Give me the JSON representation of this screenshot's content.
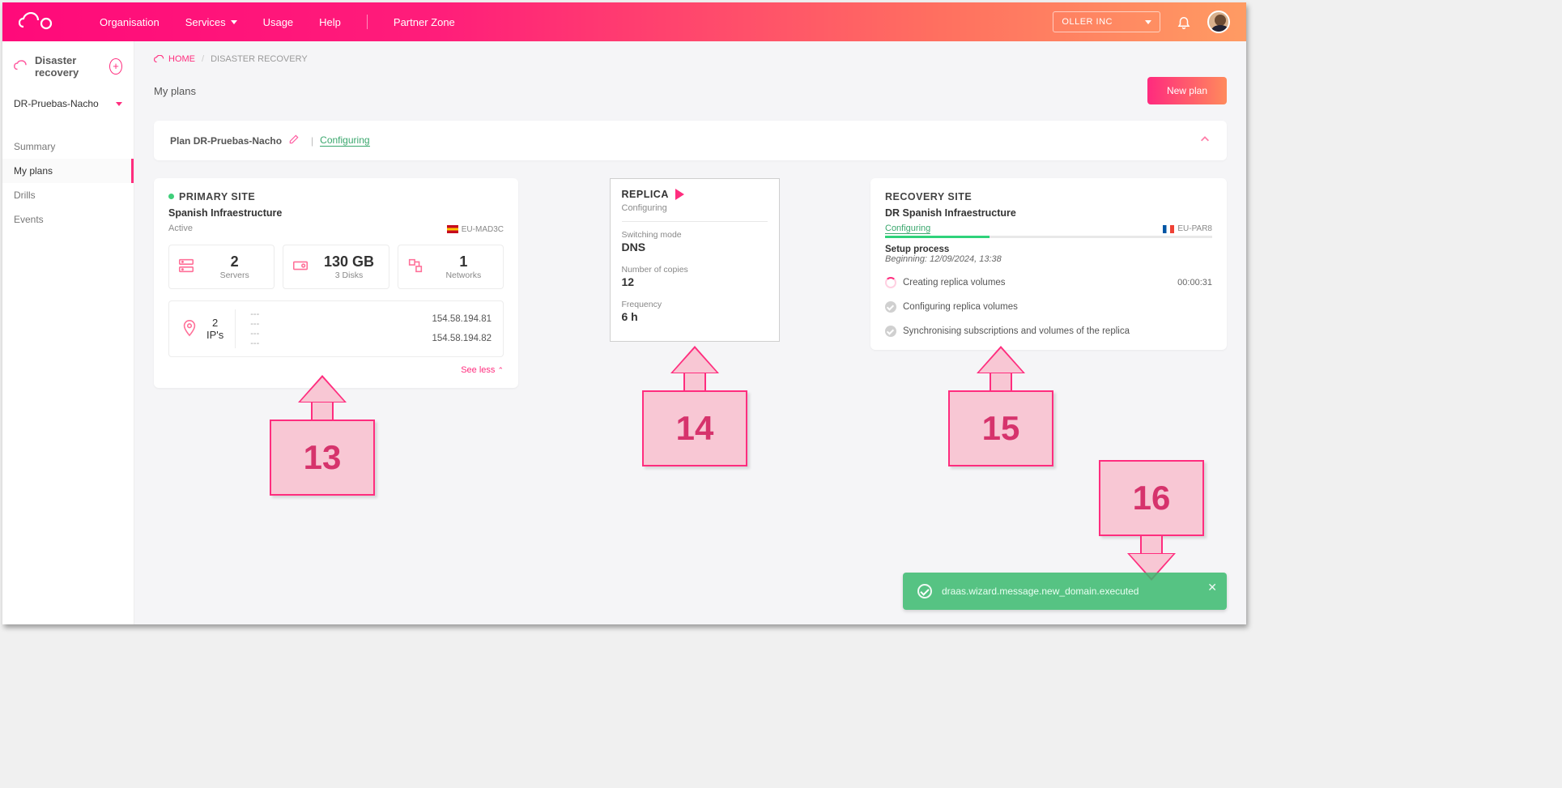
{
  "topbar": {
    "nav": [
      "Organisation",
      "Services",
      "Usage",
      "Help",
      "Partner Zone"
    ],
    "org": "OLLER INC"
  },
  "sidebar": {
    "title": "Disaster recovery",
    "planSelected": "DR-Pruebas-Nacho",
    "links": [
      "Summary",
      "My plans",
      "Drills",
      "Events"
    ],
    "activeIndex": 1
  },
  "breadcrumb": {
    "home": "HOME",
    "current": "DISASTER RECOVERY"
  },
  "page": {
    "title": "My plans",
    "newPlanBtn": "New plan"
  },
  "planBar": {
    "prefix": "Plan",
    "name": "DR-Pruebas-Nacho",
    "status": "Configuring"
  },
  "primary": {
    "heading": "PRIMARY SITE",
    "name": "Spanish Infraestructure",
    "state": "Active",
    "region": "EU-MAD3C",
    "stats": {
      "serversNum": "2",
      "serversLabel": "Servers",
      "disksNum": "130 GB",
      "disksLabel": "3 Disks",
      "netNum": "1",
      "netLabel": "Networks"
    },
    "ips": {
      "count": "2",
      "label": "IP's",
      "dashes": [
        "---",
        "---",
        "---",
        "---"
      ],
      "addrs": [
        "154.58.194.81",
        "154.58.194.82"
      ]
    },
    "seeLess": "See less"
  },
  "replica": {
    "heading": "REPLICA",
    "state": "Configuring",
    "switchLabel": "Switching mode",
    "switchVal": "DNS",
    "copiesLabel": "Number of copies",
    "copiesVal": "12",
    "freqLabel": "Frequency",
    "freqVal": "6 h"
  },
  "recovery": {
    "heading": "RECOVERY SITE",
    "name": "DR Spanish Infraestructure",
    "state": "Configuring",
    "region": "EU-PAR8",
    "progressPct": 32,
    "setupHead": "Setup process",
    "beginLabel": "Beginning:",
    "beginTime": "12/09/2024, 13:38",
    "steps": [
      {
        "text": "Creating replica volumes",
        "time": "00:00:31",
        "state": "running"
      },
      {
        "text": "Configuring replica volumes",
        "state": "pending"
      },
      {
        "text": "Synchronising subscriptions and volumes of the replica",
        "state": "pending"
      }
    ]
  },
  "annotations": {
    "a13": "13",
    "a14": "14",
    "a15": "15",
    "a16": "16"
  },
  "toast": {
    "msg": "draas.wizard.message.new_domain.executed"
  }
}
